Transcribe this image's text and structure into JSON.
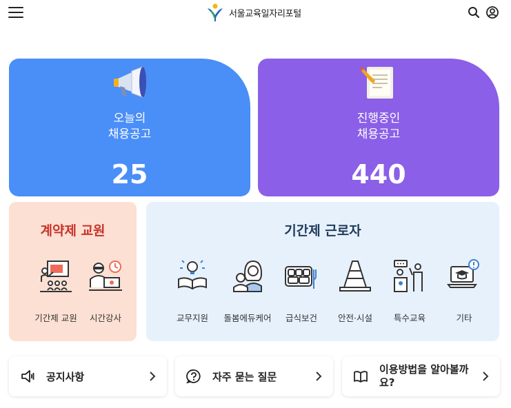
{
  "header": {
    "logo_text": "서울교육일자리포털"
  },
  "hero": {
    "today": {
      "label": "오늘의\n채용공고",
      "count": "25"
    },
    "ongoing": {
      "label": "진행중인\n채용공고",
      "count": "440"
    }
  },
  "contract": {
    "title": "계약제 교원",
    "items": [
      {
        "label": "기간제 교원"
      },
      {
        "label": "시간강사"
      }
    ]
  },
  "temp": {
    "title": "기간제 근로자",
    "items": [
      {
        "label": "교무지원"
      },
      {
        "label": "돌봄에듀케어"
      },
      {
        "label": "급식보건"
      },
      {
        "label": "안전·시설"
      },
      {
        "label": "특수교육"
      },
      {
        "label": "기타"
      }
    ]
  },
  "links": {
    "notice": "공지사항",
    "faq": "자주 묻는 질문",
    "guide": "이용방법을 알아볼까요?"
  },
  "colors": {
    "today": "#4a8ef7",
    "ongoing": "#8b5fe8",
    "contract_bg": "#fce0d3",
    "temp_bg": "#e7f1fc",
    "contract_title": "#c8322a"
  }
}
